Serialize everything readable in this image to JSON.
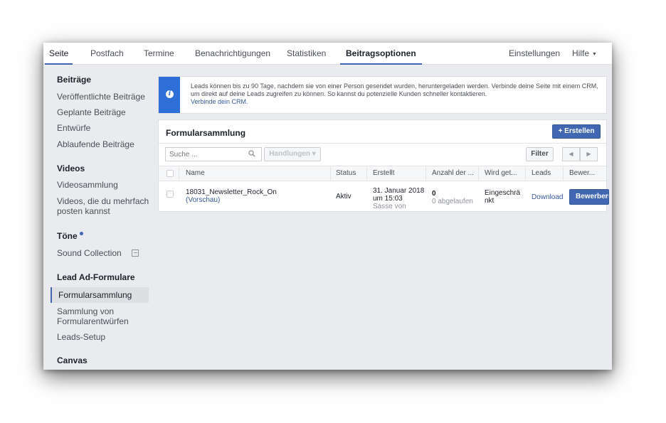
{
  "topnav": {
    "tabs": [
      {
        "label": "Seite"
      },
      {
        "label": "Postfach"
      },
      {
        "label": "Termine"
      },
      {
        "label": "Benachrichtigungen"
      },
      {
        "label": "Statistiken"
      },
      {
        "label": "Beitragsoptionen"
      },
      {
        "label": "Einstellungen"
      },
      {
        "label": "Hilfe"
      }
    ],
    "help_caret": "▼"
  },
  "sidebar": {
    "section_posts": "Beiträge",
    "posts_items": [
      "Veröffentlichte Beiträge",
      "Geplante Beiträge",
      "Entwürfe",
      "Ablaufende Beiträge"
    ],
    "section_videos": "Videos",
    "videos_items": [
      "Videosammlung",
      "Videos, die du mehrfach posten kannst"
    ],
    "section_sounds": "Töne",
    "sounds_items": [
      "Sound Collection"
    ],
    "section_leadads": "Lead Ad-Formulare",
    "leadads_items": [
      "Formularsammlung",
      "Sammlung von Formularentwürfen",
      "Leads-Setup"
    ],
    "section_canvas": "Canvas"
  },
  "info": {
    "text": "Leads können bis zu 90 Tage, nachdem sie von einer Person gesendet wurden, heruntergeladen werden. Verbinde deine Seite mit einem CRM, um direkt auf deine Leads zugreifen zu können. So kannst du potenzielle Kunden schneller kontaktieren.",
    "link": "Verbinde dein CRM.",
    "icon_glyph": "i"
  },
  "panel": {
    "title": "Formularsammlung",
    "create_label": "+ Erstellen",
    "search_placeholder": "Suche ...",
    "actions_label": "Handlungen ▾",
    "filter_label": "Filter",
    "pager_prev": "◀",
    "pager_next": "▶",
    "columns": [
      "Name",
      "Status",
      "Erstellt",
      "Anzahl der ...",
      "Wird get...",
      "Leads",
      "Bewer..."
    ],
    "rows": [
      {
        "name": "18031_Newsletter_Rock_On",
        "preview_open": "(",
        "preview_link": "Vorschau",
        "preview_close": ")",
        "status": "Aktiv",
        "created_line1": "31. Januar 2018",
        "created_line2": "um 15:03",
        "created_line3": "Sasse von",
        "count": "0",
        "count_sub": "0 abgelaufen",
        "used_line1": "Eingeschrä",
        "used_line2": "nkt",
        "leads_link": "Download",
        "promote_label": "Bewerben"
      }
    ]
  },
  "colors": {
    "accent": "#4267b2",
    "info_band": "#2d6fd6",
    "link": "#365899",
    "background": "#e9ebee"
  }
}
